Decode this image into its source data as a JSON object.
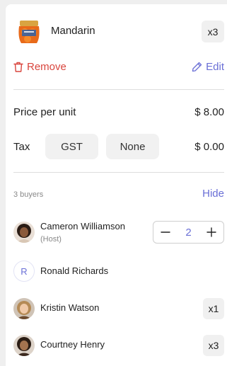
{
  "item": {
    "name": "Mandarin",
    "quantity": "x3",
    "thumbnail_icon": "mandarin-bag-image"
  },
  "actions": {
    "remove_label": "Remove",
    "edit_label": "Edit"
  },
  "pricing": {
    "price_label": "Price per unit",
    "price_value": "$ 8.00",
    "tax_label": "Tax",
    "tax_options": [
      "GST",
      "None"
    ],
    "tax_value": "$ 0.00"
  },
  "buyers": {
    "count_label": "3 buyers",
    "hide_label": "Hide",
    "list": [
      {
        "name": "Cameron Williamson",
        "role": "(Host)",
        "quantity": "2"
      },
      {
        "name": "Ronald Richards",
        "initial": "R"
      },
      {
        "name": "Kristin Watson",
        "quantity": "x1"
      },
      {
        "name": "Courtney Henry",
        "quantity": "x3"
      }
    ]
  },
  "colors": {
    "accent": "#6a6fd6",
    "danger": "#d9453d",
    "chip_bg": "#f1f1f1",
    "divider": "#dedede"
  }
}
